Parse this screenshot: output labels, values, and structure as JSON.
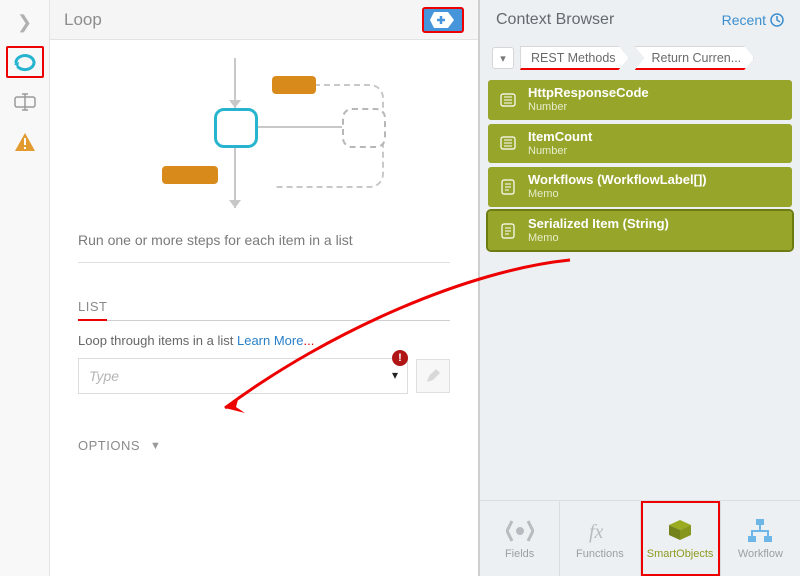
{
  "center": {
    "title": "Loop",
    "description": "Run one or more steps for each item in a list",
    "sections": {
      "list_label": "LIST",
      "list_hint_prefix": "Loop through items in a list ",
      "list_hint_link": "Learn More",
      "list_hint_suffix": "...",
      "type_placeholder": "Type",
      "options_label": "OPTIONS"
    }
  },
  "insert_btn": {
    "glyph": "+"
  },
  "context": {
    "title": "Context Browser",
    "recent_label": "Recent",
    "breadcrumbs": [
      "REST Methods",
      "Return Curren..."
    ],
    "items": [
      {
        "name": "HttpResponseCode",
        "sub": "Number"
      },
      {
        "name": "ItemCount",
        "sub": "Number"
      },
      {
        "name": "Workflows (WorkflowLabel[])",
        "sub": "Memo"
      },
      {
        "name": "Serialized Item (String)",
        "sub": "Memo"
      }
    ],
    "tabs": [
      {
        "label": "Fields"
      },
      {
        "label": "Functions"
      },
      {
        "label": "SmartObjects"
      },
      {
        "label": "Workflow"
      }
    ]
  },
  "err": {
    "glyph": "!"
  }
}
